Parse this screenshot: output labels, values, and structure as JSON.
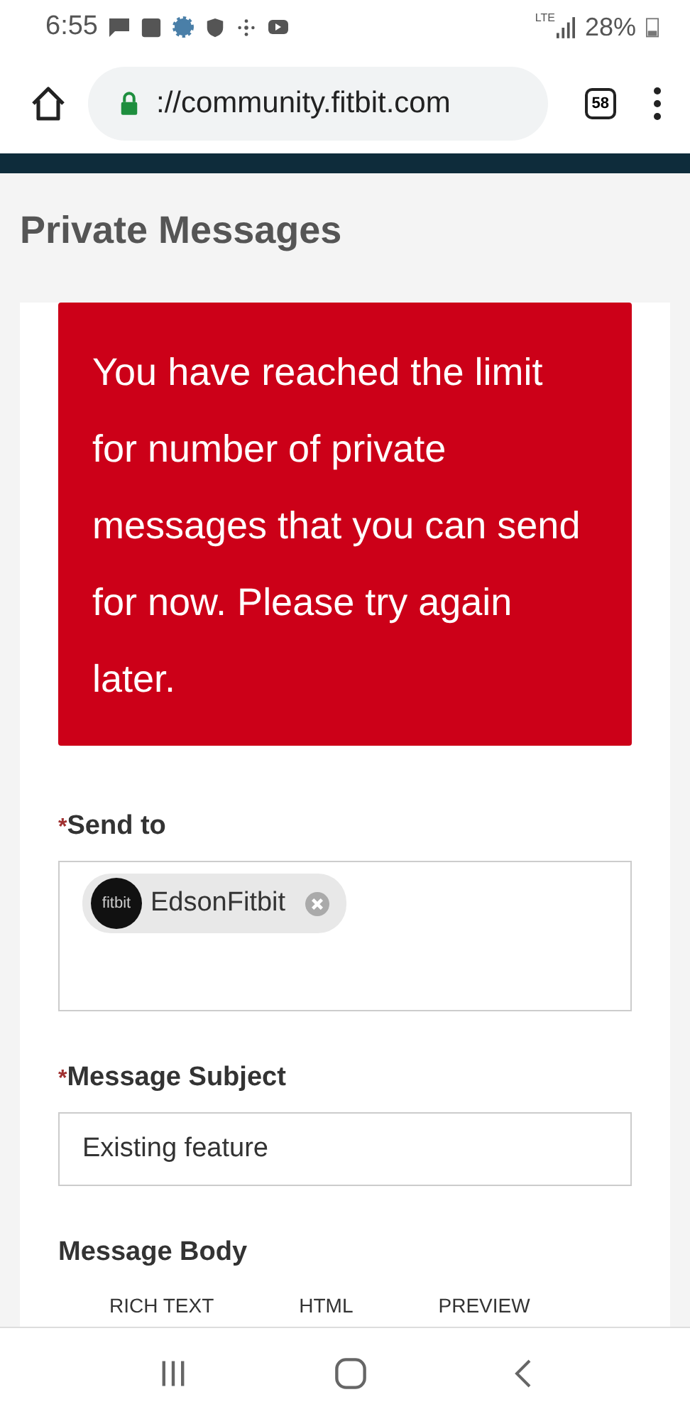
{
  "status_bar": {
    "time": "6:55",
    "battery": "28%",
    "network": "LTE"
  },
  "browser": {
    "url": "://community.fitbit.com",
    "tab_count": "58"
  },
  "page": {
    "title": "Private Messages"
  },
  "alert": {
    "message": "You have reached the limit for number of private messages that you can send for now. Please try again later."
  },
  "form": {
    "send_to": {
      "required_mark": "*",
      "label": "Send to",
      "recipients": [
        {
          "avatar_text": "fitbit",
          "name": "EdsonFitbit"
        }
      ]
    },
    "subject": {
      "required_mark": "*",
      "label": "Message Subject",
      "value": "Existing feature"
    },
    "body": {
      "label": "Message Body",
      "tabs": [
        {
          "label": "RICH TEXT"
        },
        {
          "label": "HTML"
        },
        {
          "label": "PREVIEW"
        }
      ]
    }
  }
}
